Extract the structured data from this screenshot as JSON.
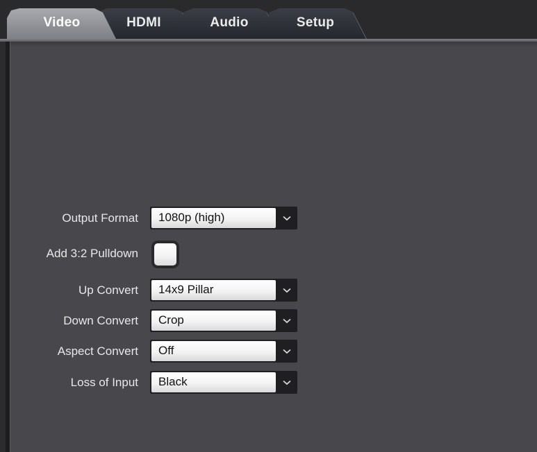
{
  "tabs": [
    {
      "label": "Video",
      "active": true
    },
    {
      "label": "HDMI",
      "active": false
    },
    {
      "label": "Audio",
      "active": false
    },
    {
      "label": "Setup",
      "active": false
    }
  ],
  "form": {
    "output_format": {
      "label": "Output Format",
      "value": "1080p (high)"
    },
    "pulldown": {
      "label": "Add 3:2 Pulldown",
      "checked": false
    },
    "up_convert": {
      "label": "Up Convert",
      "value": "14x9 Pillar"
    },
    "down_convert": {
      "label": "Down Convert",
      "value": "Crop"
    },
    "aspect_convert": {
      "label": "Aspect Convert",
      "value": "Off"
    },
    "loss_of_input": {
      "label": "Loss of Input",
      "value": "Black"
    }
  },
  "icons": {
    "dropdown": "chevron-down-icon"
  },
  "colors": {
    "panel_bg": "#48484c",
    "tabbar_bg": "#2a2a2d",
    "active_tab": "#8f9197",
    "inactive_tab": "#2d3037",
    "label_text": "#e8e8ea"
  }
}
